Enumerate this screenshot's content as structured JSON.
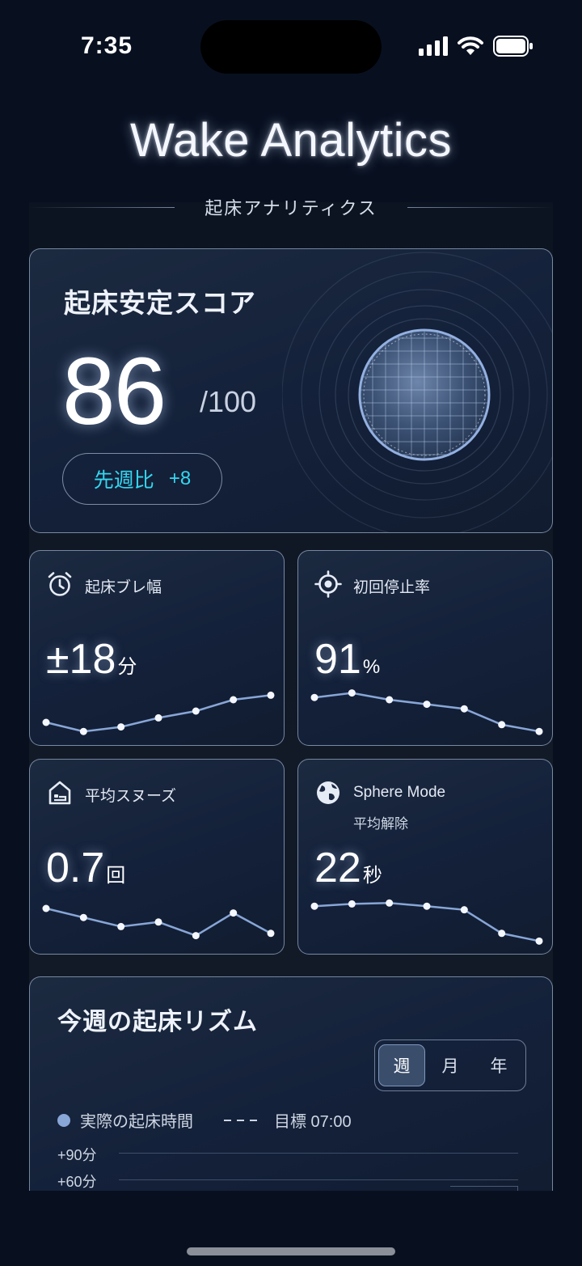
{
  "status_bar": {
    "time": "7:35"
  },
  "header": {
    "title": "Wake Analytics",
    "subtitle": "起床アナリティクス"
  },
  "score_card": {
    "label": "起床安定スコア",
    "value": "86",
    "max": "/100",
    "delta_label": "先週比",
    "delta_value": "+8"
  },
  "metrics": [
    {
      "label": "起床ブレ幅",
      "sublabel": "",
      "value": "±18",
      "unit": "分",
      "icon": "alarm-clock-icon",
      "trend": [
        0.25,
        0.05,
        0.15,
        0.35,
        0.5,
        0.75,
        0.85
      ]
    },
    {
      "label": "初回停止率",
      "sublabel": "",
      "value": "91",
      "unit": "%",
      "icon": "target-icon",
      "trend": [
        0.8,
        0.9,
        0.75,
        0.65,
        0.55,
        0.2,
        0.05
      ]
    },
    {
      "label": "平均スヌーズ",
      "sublabel": "",
      "value": "0.7",
      "unit": "回",
      "icon": "bed-home-icon",
      "trend": [
        0.75,
        0.55,
        0.35,
        0.45,
        0.15,
        0.65,
        0.2
      ]
    },
    {
      "label": "Sphere Mode",
      "sublabel": "平均解除",
      "value": "22",
      "unit": "秒",
      "icon": "globe-icon",
      "trend": [
        0.8,
        0.85,
        0.87,
        0.8,
        0.72,
        0.2,
        0.03
      ]
    }
  ],
  "rhythm": {
    "title": "今週の起床リズム",
    "tabs": [
      {
        "label": "週",
        "active": true
      },
      {
        "label": "月",
        "active": false
      },
      {
        "label": "年",
        "active": false
      }
    ],
    "legend_actual": "実際の起床時間",
    "legend_target": "目標 07:00",
    "axis_labels": [
      "+90分",
      "+60分"
    ]
  },
  "colors": {
    "accent": "#34d7f0",
    "line": "#88a6d6",
    "background": "#081020"
  }
}
